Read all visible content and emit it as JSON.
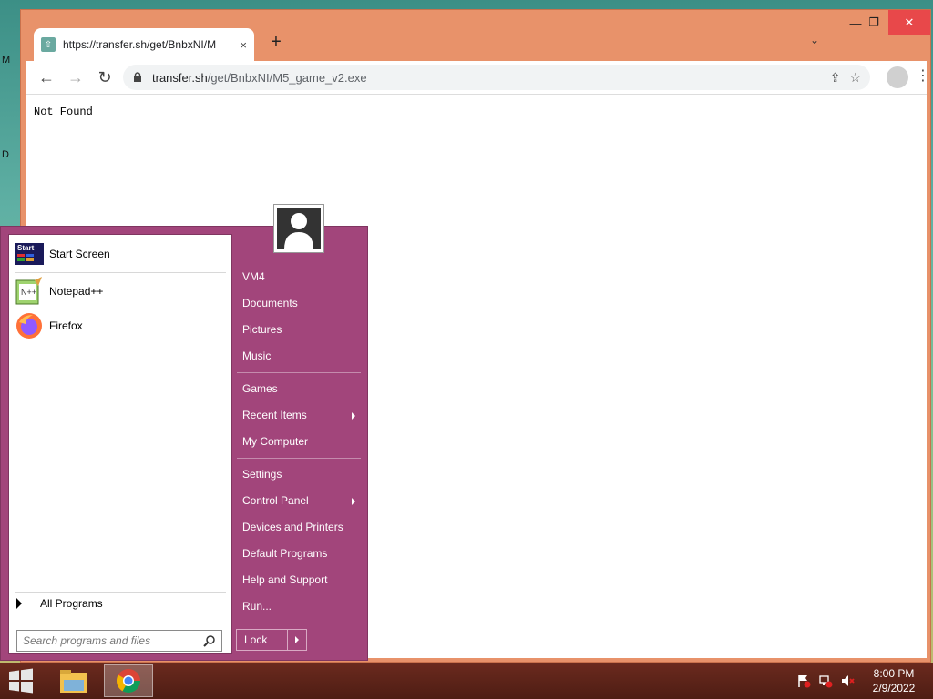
{
  "desktop": {
    "stub_top": "M",
    "stub_mid": "D"
  },
  "browser": {
    "tab_title": "https://transfer.sh/get/BnbxNI/M",
    "new_tab": "+",
    "tab_close": "×",
    "tab_list": "⌄",
    "window_min": "—",
    "window_max": "❐",
    "window_close": "✕",
    "back": "←",
    "forward": "→",
    "reload": "↻",
    "url_host": "transfer.sh",
    "url_path": "/get/BnbxNI/M5_game_v2.exe",
    "share_icon": "⇪",
    "star_icon": "☆",
    "menu_icon": "⋮",
    "page_text": "Not Found"
  },
  "start_menu": {
    "pinned": [
      {
        "label": "Start Screen",
        "icon": "start-screen-icon"
      },
      {
        "label": "Notepad++",
        "icon": "notepadpp-icon"
      },
      {
        "label": "Firefox",
        "icon": "firefox-icon"
      }
    ],
    "all_programs": "All Programs",
    "search_placeholder": "Search programs and files",
    "right_items": [
      "VM4",
      "Documents",
      "Pictures",
      "Music",
      "Games",
      "Recent Items",
      "My Computer",
      "Settings",
      "Control Panel",
      "Devices and Printers",
      "Default Programs",
      "Help and Support",
      "Run..."
    ],
    "lock_label": "Lock"
  },
  "taskbar": {
    "time": "8:00 PM",
    "date": "2/9/2022"
  },
  "colors": {
    "chrome_frame": "#e8926a",
    "start_menu": "#a2457b",
    "taskbar": "#5a2218"
  }
}
